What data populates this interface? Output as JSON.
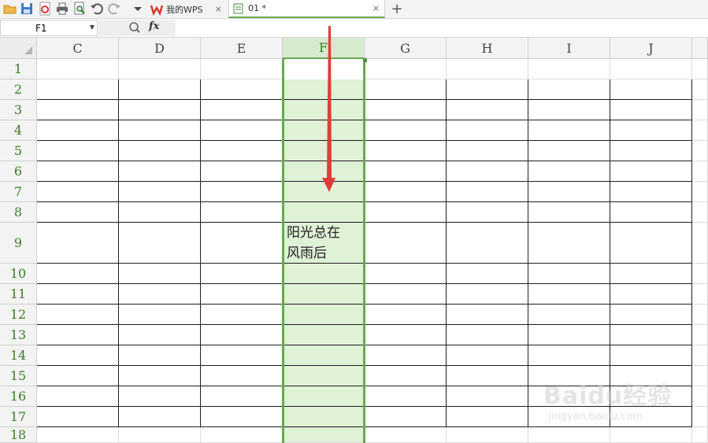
{
  "toolbar": {
    "icons": [
      "open-folder-icon",
      "save-icon",
      "export-pdf-icon",
      "print-icon",
      "print-preview-icon",
      "undo-icon",
      "redo-icon",
      "customize-dropdown-icon"
    ]
  },
  "tabs": [
    {
      "label": "我的WPS",
      "icon": "wps-logo-icon",
      "close": "×",
      "active": false
    },
    {
      "label": "01 *",
      "icon": "spreadsheet-doc-icon",
      "close": "×",
      "active": true
    }
  ],
  "new_tab": "+",
  "formula_bar": {
    "name_box": "F1",
    "fx_label": "fx",
    "formula": ""
  },
  "columns": [
    "C",
    "D",
    "E",
    "F",
    "G",
    "H",
    "I",
    "J"
  ],
  "selected_column": "F",
  "rows": [
    "1",
    "2",
    "3",
    "4",
    "5",
    "6",
    "7",
    "8",
    "9",
    "10",
    "11",
    "12",
    "13",
    "14",
    "15",
    "16",
    "17",
    "18"
  ],
  "cell_F9": {
    "line1": "阳光总在",
    "line2": "风雨后"
  },
  "watermark": {
    "brand": "Baidu经验",
    "sub": "jingyan.baidu.com"
  },
  "colors": {
    "selection": "#6aa84f",
    "selection_fill": "#dff1d6",
    "arrow": "#e03c3c"
  }
}
